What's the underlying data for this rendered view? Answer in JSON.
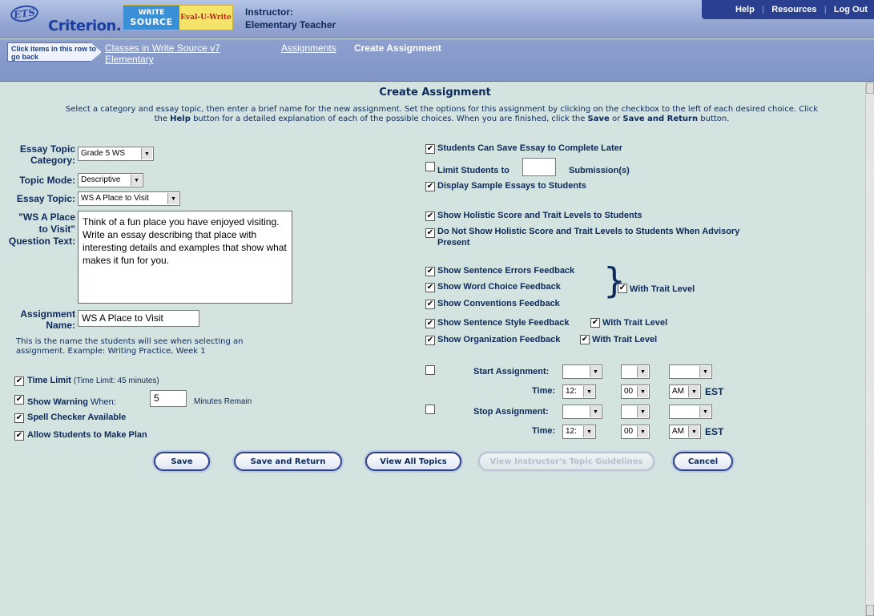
{
  "header": {
    "ets_logo": "ETS",
    "criterion_logo": "Criterion.",
    "write_source_logo": {
      "line1": "WRITE",
      "line2": "SOURCE",
      "eval": "Eval-U-Write"
    },
    "instructor_label": "Instructor:",
    "instructor_name": "Elementary Teacher",
    "nav": {
      "help": "Help",
      "resources": "Resources",
      "logout": "Log Out",
      "separator": "|"
    }
  },
  "breadcrumb": {
    "hint": "Click items in this row to go back",
    "class_link": "Classes in Write Source v7 Elementary",
    "assignments_link": "Assignments",
    "current": "Create Assignment"
  },
  "main": {
    "title": "Create Assignment",
    "intro": {
      "p1": "Select a category and essay topic, then enter a brief name for the new assignment. Set the options for this assignment by clicking on the checkbox to the left of each desired choice. Click the ",
      "help_word": "Help",
      "p2": " button for a detailed explanation of each of the possible choices. When you are finished, click the ",
      "save_word": "Save",
      "or_word": " or ",
      "save_return_word": "Save and Return",
      "p3": " button."
    }
  },
  "form": {
    "essay_topic_category_label": "Essay Topic Category:",
    "essay_topic_category_value": "Grade 5 WS",
    "topic_mode_label": "Topic Mode:",
    "topic_mode_value": "Descriptive",
    "essay_topic_label": "Essay Topic:",
    "essay_topic_value": "WS A Place to Visit",
    "question_label": "\"WS A Place to Visit\" Question Text:",
    "question_text": "Think of a fun place you have enjoyed visiting. Write an essay describing that place with interesting details and examples that show what makes it fun for you.",
    "assignment_name_label": "Assignment Name:",
    "assignment_name_value": "WS A Place to Visit",
    "assignment_name_help": "This is the name the students will see when selecting an assignment. Example: Writing Practice, Week 1"
  },
  "left_options": {
    "time_limit": {
      "label": "Time Limit",
      "detail": "(Time Limit: 45 minutes)",
      "checked": true
    },
    "show_warning": {
      "label": "Show Warning",
      "when": "When:",
      "value": "5",
      "suffix": "Minutes Remain",
      "checked": true
    },
    "spell_checker": {
      "label": "Spell Checker Available",
      "checked": true
    },
    "make_plan": {
      "label": "Allow Students to Make Plan",
      "checked": true
    }
  },
  "right_options": {
    "save_later": {
      "label": "Students Can Save Essay to Complete Later",
      "checked": true
    },
    "limit_submissions": {
      "label_pre": "Limit Students to",
      "value": "",
      "label_post": "Submission(s)",
      "checked": false
    },
    "sample_essays": {
      "label": "Display Sample Essays to Students",
      "checked": true
    },
    "holistic": {
      "label": "Show Holistic Score and Trait Levels to Students",
      "checked": true
    },
    "advisory": {
      "label": "Do Not Show Holistic Score and Trait Levels to Students When Advisory Present",
      "checked": true
    },
    "sentence_errors": {
      "label": "Show Sentence Errors Feedback",
      "checked": true
    },
    "word_choice": {
      "label": "Show Word Choice Feedback",
      "checked": true
    },
    "conventions": {
      "label": "Show Conventions Feedback",
      "checked": true
    },
    "group_trait": {
      "label": "With Trait Level",
      "checked": true
    },
    "sentence_style": {
      "label": "Show Sentence Style Feedback",
      "trait_label": "With Trait Level",
      "checked": true,
      "trait_checked": true
    },
    "organization": {
      "label": "Show Organization Feedback",
      "trait_label": "With Trait Level",
      "checked": true,
      "trait_checked": true
    }
  },
  "schedule": {
    "start_label": "Start Assignment:",
    "stop_label": "Stop Assignment:",
    "time_label": "Time:",
    "hour": "12:",
    "minute": "00",
    "ampm": "AM",
    "tz": "EST",
    "start_checked": false,
    "stop_checked": false
  },
  "buttons": {
    "save": "Save",
    "save_return": "Save and Return",
    "view_topics": "View All Topics",
    "view_guidelines": "View Instructor's Topic Guidelines",
    "cancel": "Cancel"
  },
  "check_glyph": "✔"
}
